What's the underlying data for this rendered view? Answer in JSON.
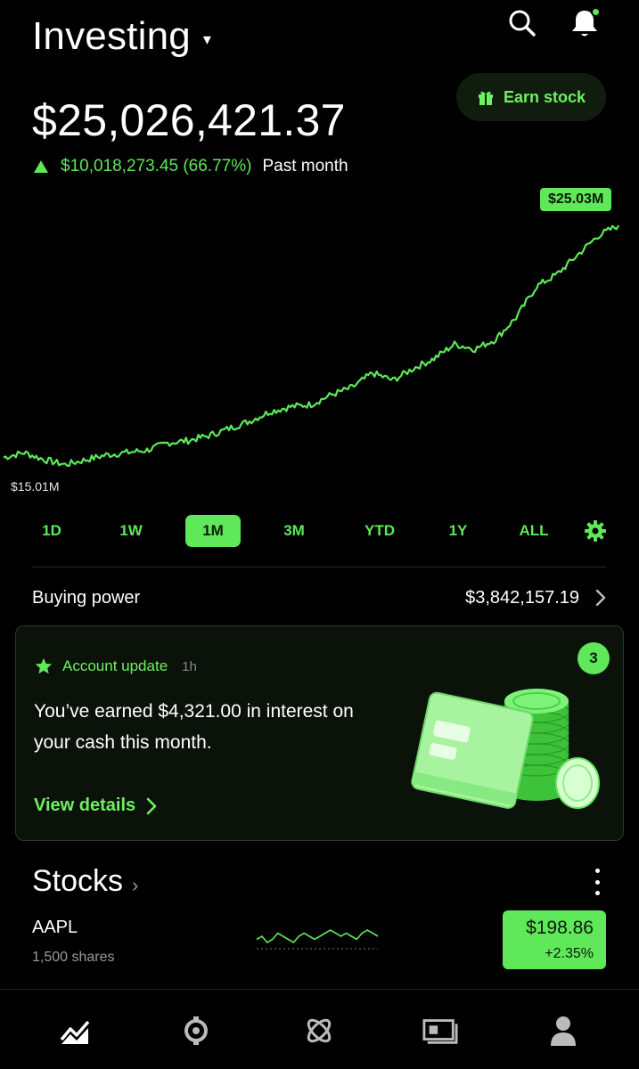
{
  "header": {
    "title": "Investing",
    "title_caret": "▾",
    "icons": [
      "search-icon",
      "bell-icon"
    ],
    "earn_button": "Earn stock"
  },
  "portfolio": {
    "balance": "$25,026,421.37",
    "change": "$10,018,273.45 (66.77%)",
    "period": "Past month"
  },
  "chart_data": {
    "type": "line",
    "title": "",
    "max_label": "$25.03M",
    "min_label": "$15.01M",
    "x": [
      0,
      1,
      2,
      3,
      4,
      5,
      6,
      7,
      8,
      9,
      10,
      11,
      12,
      13,
      14,
      15,
      16,
      17,
      18,
      19,
      20,
      21,
      22,
      23,
      24,
      25,
      26,
      27,
      28,
      29,
      30
    ],
    "y": [
      15.4,
      15.6,
      15.3,
      15.1,
      15.3,
      15.5,
      15.6,
      15.7,
      16.0,
      16.1,
      16.3,
      16.6,
      16.9,
      17.3,
      17.5,
      17.6,
      18.0,
      18.3,
      18.9,
      18.6,
      19.1,
      19.5,
      20.1,
      19.9,
      20.3,
      21.2,
      22.5,
      23.0,
      23.8,
      24.6,
      25.03
    ],
    "ylim": [
      14.9,
      25.4
    ],
    "color": "#5ee85a",
    "grid": false
  },
  "ranges": {
    "items": [
      "1D",
      "1W",
      "1M",
      "3M",
      "YTD",
      "1Y",
      "ALL"
    ],
    "selected": "1M",
    "settings_icon": "gear-icon"
  },
  "buying_power": {
    "label": "Buying power",
    "value": "$3,842,157.19"
  },
  "update_card": {
    "label": "Account update",
    "time": "1h",
    "body": "You’ve earned $4,321.00 in interest on your cash this month.",
    "link": "View details",
    "count": "3",
    "illustration": "credit-card-and-coins-illustration"
  },
  "stocks": {
    "heading": "Stocks",
    "rows": [
      {
        "symbol": "AAPL",
        "shares": "1,500 shares",
        "price": "$198.86",
        "change": "+2.35%",
        "spark": [
          3,
          4,
          2,
          3,
          5,
          4,
          3,
          2,
          4,
          5,
          4,
          3,
          4,
          5,
          6,
          5,
          4,
          5,
          4,
          3,
          5,
          6,
          5,
          4
        ]
      }
    ]
  },
  "tabbar": {
    "tabs": [
      "investing-tab",
      "crypto-tab",
      "network-tab",
      "cash-tab",
      "account-tab"
    ],
    "selected": "investing-tab"
  },
  "colors": {
    "accent": "#5ee85a",
    "background": "#000000",
    "card_bg": "#0a120a"
  }
}
